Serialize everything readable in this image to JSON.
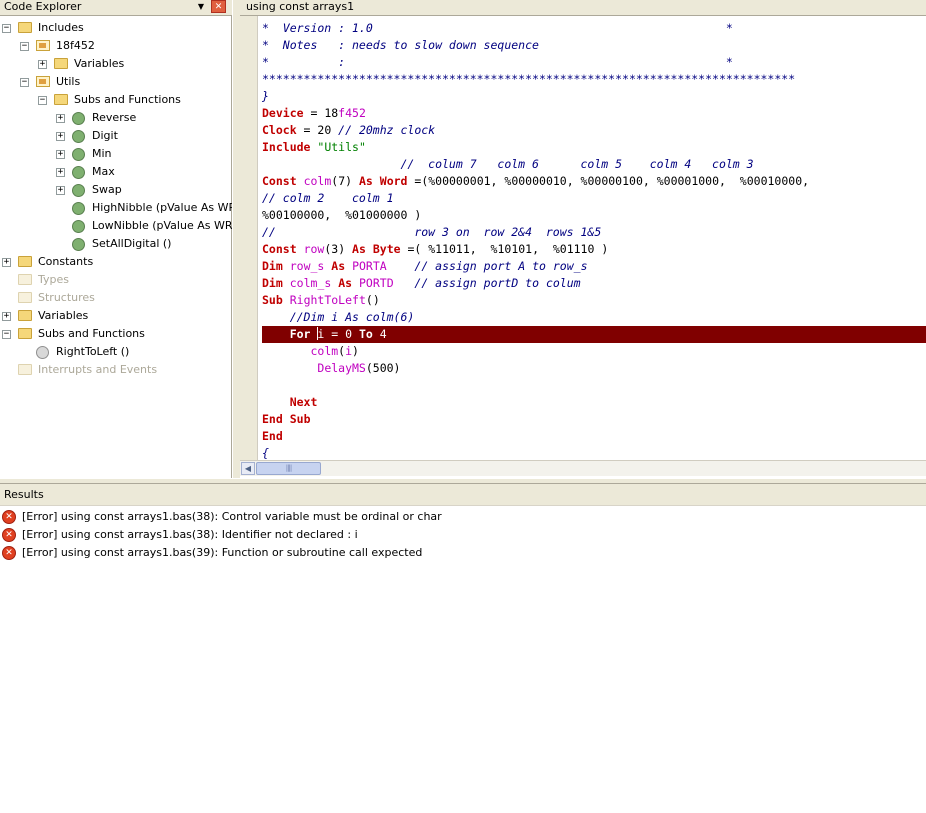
{
  "explorer": {
    "title": "Code Explorer",
    "dropdown_icon": "▼",
    "close_icon": "✕",
    "tree": [
      {
        "label": "Includes",
        "icon": "folder",
        "expander": "−",
        "dim": false
      },
      {
        "label": "18f452",
        "icon": "file",
        "expander": "−",
        "dim": false
      },
      {
        "label": "Variables",
        "icon": "folder",
        "expander": "+",
        "dim": false
      },
      {
        "label": "Utils",
        "icon": "file",
        "expander": "−",
        "dim": false
      },
      {
        "label": "Subs and Functions",
        "icon": "folder",
        "expander": "−",
        "dim": false
      },
      {
        "label": "Reverse",
        "icon": "gear",
        "expander": "+",
        "dim": false
      },
      {
        "label": "Digit",
        "icon": "gear",
        "expander": "+",
        "dim": false
      },
      {
        "label": "Min",
        "icon": "gear",
        "expander": "+",
        "dim": false
      },
      {
        "label": "Max",
        "icon": "gear",
        "expander": "+",
        "dim": false
      },
      {
        "label": "Swap",
        "icon": "gear",
        "expander": "+",
        "dim": false
      },
      {
        "label": "HighNibble (pValue As WREG",
        "icon": "gear",
        "expander": "",
        "dim": false
      },
      {
        "label": "LowNibble (pValue As WREG",
        "icon": "gear",
        "expander": "",
        "dim": false
      },
      {
        "label": "SetAllDigital ()",
        "icon": "gear",
        "expander": "",
        "dim": false
      },
      {
        "label": "Constants",
        "icon": "folder",
        "expander": "+",
        "dim": false
      },
      {
        "label": "Types",
        "icon": "folder",
        "expander": "",
        "dim": true
      },
      {
        "label": "Structures",
        "icon": "folder",
        "expander": "",
        "dim": true
      },
      {
        "label": "Variables",
        "icon": "folder",
        "expander": "+",
        "dim": false
      },
      {
        "label": "Subs and Functions",
        "icon": "folder",
        "expander": "−",
        "dim": false
      },
      {
        "label": "RightToLeft ()",
        "icon": "gear-gray",
        "expander": "",
        "dim": false
      },
      {
        "label": "Interrupts and Events",
        "icon": "folder",
        "expander": "",
        "dim": true
      }
    ]
  },
  "editor": {
    "tab_title": "using const arrays1",
    "lines": [
      [
        [
          "c",
          "*  Version : 1.0                                                   *"
        ]
      ],
      [
        [
          "c",
          "*  Notes   : needs to slow down sequence"
        ]
      ],
      [
        [
          "c",
          "*          :                                                       *"
        ]
      ],
      [
        [
          "c",
          "*****************************************************************************"
        ]
      ],
      [
        [
          "c",
          "}"
        ]
      ],
      [
        [
          "k",
          "Device"
        ],
        [
          "t",
          " = 18"
        ],
        [
          "m",
          "f452"
        ]
      ],
      [
        [
          "k",
          "Clock"
        ],
        [
          "t",
          " = 20 "
        ],
        [
          "c",
          "// 20mhz clock"
        ]
      ],
      [
        [
          "k",
          "Include"
        ],
        [
          "t",
          " "
        ],
        [
          "s",
          "\"Utils\""
        ]
      ],
      [
        [
          "c",
          "                    //  colum 7   colm 6      colm 5    colm 4   colm 3"
        ]
      ],
      [
        [
          "k",
          "Const"
        ],
        [
          "t",
          " "
        ],
        [
          "m",
          "colm"
        ],
        [
          "t",
          "(7) "
        ],
        [
          "k",
          "As"
        ],
        [
          "t",
          " "
        ],
        [
          "k",
          "Word"
        ],
        [
          "t",
          " =(%00000001, %00000010, %00000100, %00001000,  %00010000,"
        ]
      ],
      [
        [
          "c",
          "// colm 2    colm 1"
        ]
      ],
      [
        [
          "t",
          "%00100000,  %01000000 )"
        ]
      ],
      [
        [
          "c",
          "//                    row 3 on  row 2&4  rows 1&5"
        ]
      ],
      [
        [
          "k",
          "Const"
        ],
        [
          "t",
          " "
        ],
        [
          "m",
          "row"
        ],
        [
          "t",
          "(3) "
        ],
        [
          "k",
          "As"
        ],
        [
          "t",
          " "
        ],
        [
          "k",
          "Byte"
        ],
        [
          "t",
          " =( %11011,  %10101,  %01110 )"
        ]
      ],
      [
        [
          "k",
          "Dim"
        ],
        [
          "t",
          " "
        ],
        [
          "m",
          "row_s"
        ],
        [
          "t",
          " "
        ],
        [
          "k",
          "As"
        ],
        [
          "t",
          " "
        ],
        [
          "m",
          "PORTA"
        ],
        [
          "t",
          "    "
        ],
        [
          "c",
          "// assign port A to row_s"
        ]
      ],
      [
        [
          "k",
          "Dim"
        ],
        [
          "t",
          " "
        ],
        [
          "m",
          "colm_s"
        ],
        [
          "t",
          " "
        ],
        [
          "k",
          "As"
        ],
        [
          "t",
          " "
        ],
        [
          "m",
          "PORTD"
        ],
        [
          "t",
          "   "
        ],
        [
          "c",
          "// assign portD to colum"
        ]
      ],
      [
        [
          "k",
          "Sub"
        ],
        [
          "t",
          " "
        ],
        [
          "m",
          "RightToLeft"
        ],
        [
          "t",
          "()"
        ]
      ],
      [
        [
          "c",
          "    //Dim i As colm(6)"
        ]
      ],
      [
        [
          "t",
          "    "
        ],
        [
          "k",
          "For"
        ],
        [
          "t",
          " "
        ],
        [
          "caret",
          ""
        ],
        [
          "t",
          "i = 0 "
        ],
        [
          "k",
          "To"
        ],
        [
          "t",
          " 4"
        ]
      ],
      [
        [
          "t",
          "       "
        ],
        [
          "m",
          "colm"
        ],
        [
          "t",
          "("
        ],
        [
          "m",
          "i"
        ],
        [
          "t",
          ")"
        ]
      ],
      [
        [
          "t",
          "        "
        ],
        [
          "m",
          "DelayMS"
        ],
        [
          "t",
          "(500)"
        ]
      ],
      [
        [
          "t",
          ""
        ]
      ],
      [
        [
          "t",
          "    "
        ],
        [
          "k",
          "Next"
        ]
      ],
      [
        [
          "k",
          "End"
        ],
        [
          "t",
          " "
        ],
        [
          "k",
          "Sub"
        ]
      ],
      [
        [
          "k",
          "End"
        ]
      ],
      [
        [
          "c",
          "{"
        ]
      ]
    ],
    "highlight_line": 18
  },
  "scrollbar": {
    "left_arrow": "◀",
    "grip": "||||"
  },
  "results": {
    "title": "Results",
    "error_icon": "✕",
    "items": [
      "[Error] using const arrays1.bas(38): Control variable must be ordinal or char",
      "[Error] using const arrays1.bas(38): Identifier not declared : i",
      "[Error] using const arrays1.bas(39): Function or subroutine call expected"
    ]
  }
}
